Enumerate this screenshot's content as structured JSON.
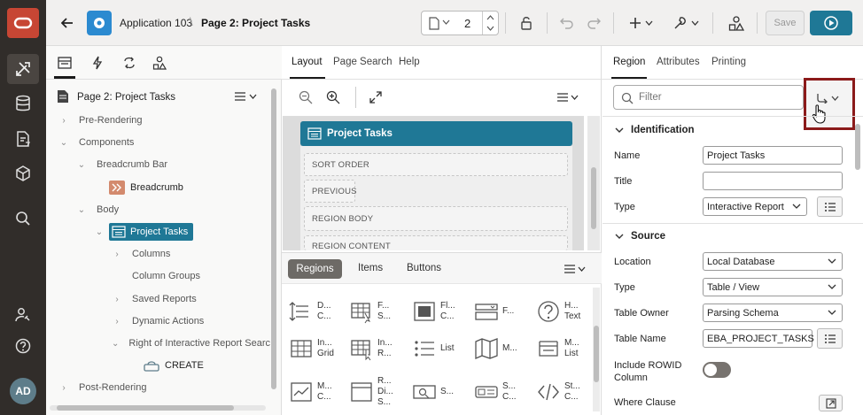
{
  "app": {
    "name": "Application 103",
    "page": "Page 2: Project Tasks"
  },
  "toolbar": {
    "page_number": "2",
    "save_label": "Save"
  },
  "left_panel": {
    "root_label": "Page 2: Project Tasks",
    "tree": [
      {
        "label": "Pre-Rendering"
      },
      {
        "label": "Components"
      },
      {
        "label": "Breadcrumb Bar"
      },
      {
        "label": "Breadcrumb"
      },
      {
        "label": "Body"
      },
      {
        "label": "Project Tasks"
      },
      {
        "label": "Columns"
      },
      {
        "label": "Column Groups"
      },
      {
        "label": "Saved Reports"
      },
      {
        "label": "Dynamic Actions"
      },
      {
        "label": "Right of Interactive Report Searc"
      },
      {
        "label": "CREATE"
      },
      {
        "label": "Post-Rendering"
      }
    ]
  },
  "middle_panel": {
    "tabs": [
      "Layout",
      "Page Search",
      "Help"
    ],
    "region_title": "Project Tasks",
    "slots": [
      "SORT ORDER",
      "PREVIOUS",
      "REGION BODY",
      "REGION CONTENT"
    ],
    "gallery_tabs": [
      "Regions",
      "Items",
      "Buttons"
    ],
    "gallery": [
      {
        "l1": "D...",
        "l2": "C..."
      },
      {
        "l1": "F...",
        "l2": "S..."
      },
      {
        "l1": "Fl...",
        "l2": "C..."
      },
      {
        "l1": "F...",
        "l2": ""
      },
      {
        "l1": "H...",
        "l2": "Text"
      },
      {
        "l1": "In...",
        "l2": "Grid"
      },
      {
        "l1": "In...",
        "l2": "R..."
      },
      {
        "l1": "List",
        "l2": ""
      },
      {
        "l1": "M...",
        "l2": ""
      },
      {
        "l1": "M...",
        "l2": "List"
      },
      {
        "l1": "M...",
        "l2": "C..."
      },
      {
        "l1": "R...",
        "l2": "Di...",
        "l3": "S..."
      },
      {
        "l1": "S...",
        "l2": ""
      },
      {
        "l1": "S...",
        "l2": "C..."
      },
      {
        "l1": "St...",
        "l2": "C..."
      }
    ]
  },
  "right_panel": {
    "tabs": [
      "Region",
      "Attributes",
      "Printing"
    ],
    "filter_placeholder": "Filter",
    "sections": {
      "identification": "Identification",
      "source": "Source"
    },
    "fields": {
      "name_label": "Name",
      "name_value": "Project Tasks",
      "title_label": "Title",
      "title_value": "",
      "type_label": "Type",
      "type_value": "Interactive Report",
      "location_label": "Location",
      "location_value": "Local Database",
      "source_type_label": "Type",
      "source_type_value": "Table / View",
      "table_owner_label": "Table Owner",
      "table_owner_value": "Parsing Schema",
      "table_name_label": "Table Name",
      "table_name_value": "EBA_PROJECT_TASKS",
      "include_rowid_label1": "Include ROWID",
      "include_rowid_label2": "Column",
      "where_clause_label": "Where Clause"
    }
  },
  "colors": {
    "nav_bg": "#312d2a",
    "brand_red": "#c74634",
    "primary": "#1f7896",
    "highlight_border": "#8b1a1a"
  }
}
